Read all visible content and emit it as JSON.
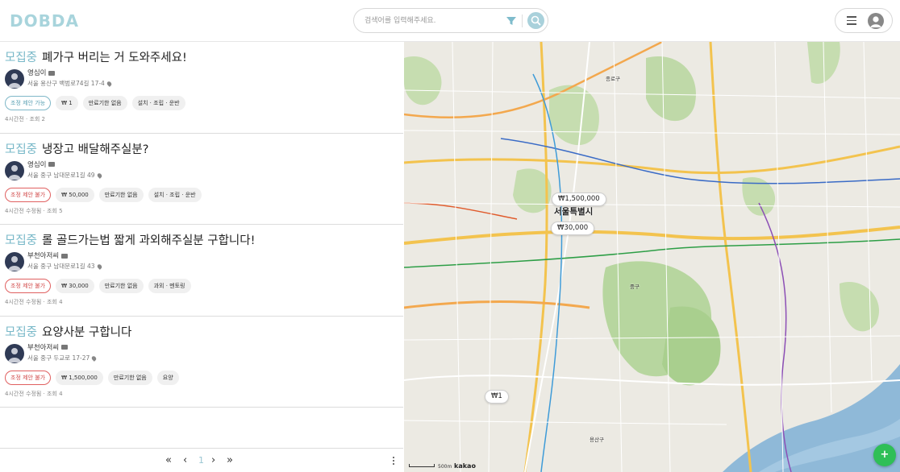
{
  "header": {
    "logo": "DOBDA",
    "search_placeholder": "검색어를 입력해주세요."
  },
  "posts": [
    {
      "status": "모집중",
      "title": "폐가구 버리는 거 도와주세요!",
      "author": "영심이",
      "address": "서울 용산구 백범로74길 17-4",
      "tags": [
        {
          "label": "조정 제안 가능",
          "kind": "adj-ok"
        },
        {
          "label": "₩ 1",
          "kind": "plain"
        },
        {
          "label": "만료기한 없음",
          "kind": "plain"
        },
        {
          "label": "설치 · 조립 · 운반",
          "kind": "plain"
        }
      ],
      "meta": "4시간전 · 조회 2"
    },
    {
      "status": "모집중",
      "title": "냉장고 배달해주실분?",
      "author": "영심이",
      "address": "서울 중구 남대문로1길 49",
      "tags": [
        {
          "label": "조정 제안 불가",
          "kind": "adj-no"
        },
        {
          "label": "₩ 50,000",
          "kind": "plain"
        },
        {
          "label": "만료기한 없음",
          "kind": "plain"
        },
        {
          "label": "설치 · 조립 · 운반",
          "kind": "plain"
        }
      ],
      "meta": "4시간전 수정됨 · 조회 5"
    },
    {
      "status": "모집중",
      "title": "롤 골드가는법 짧게 과외해주실분 구합니다!",
      "author": "부천아저씨",
      "address": "서울 중구 남대문로1길 43",
      "tags": [
        {
          "label": "조정 제안 불가",
          "kind": "adj-no"
        },
        {
          "label": "₩ 30,000",
          "kind": "plain"
        },
        {
          "label": "만료기한 없음",
          "kind": "plain"
        },
        {
          "label": "과외 · 멘토링",
          "kind": "plain"
        }
      ],
      "meta": "4시간전 수정됨 · 조회 4"
    },
    {
      "status": "모집중",
      "title": "요양사분 구합니다",
      "author": "부천아저씨",
      "address": "서울 중구 두교로 17-27",
      "tags": [
        {
          "label": "조정 제안 불가",
          "kind": "adj-no"
        },
        {
          "label": "₩ 1,500,000",
          "kind": "plain"
        },
        {
          "label": "만료기한 없음",
          "kind": "plain"
        },
        {
          "label": "요양",
          "kind": "plain"
        }
      ],
      "meta": "4시간전 수정됨 · 조회 4"
    }
  ],
  "pagination": {
    "first": "«",
    "prev": "‹",
    "current": "1",
    "next": "›",
    "last": "»"
  },
  "map": {
    "price_pins": [
      "₩1,500,000",
      "₩30,000",
      "₩1"
    ],
    "city_label": "서울특별시",
    "district_labels": [
      "중구",
      "용산구",
      "종로구"
    ],
    "attribution": "kakao",
    "scale": "500m",
    "fab_label": "+"
  },
  "colors": {
    "accent": "#78b8c8",
    "reject": "#d24a4a",
    "fab": "#2fbf57"
  },
  "icons": {
    "search": "search-icon",
    "filter": "filter-icon",
    "menu": "hamburger-icon",
    "profile": "user-icon",
    "chat": "chat-icon",
    "location": "pin-icon"
  }
}
